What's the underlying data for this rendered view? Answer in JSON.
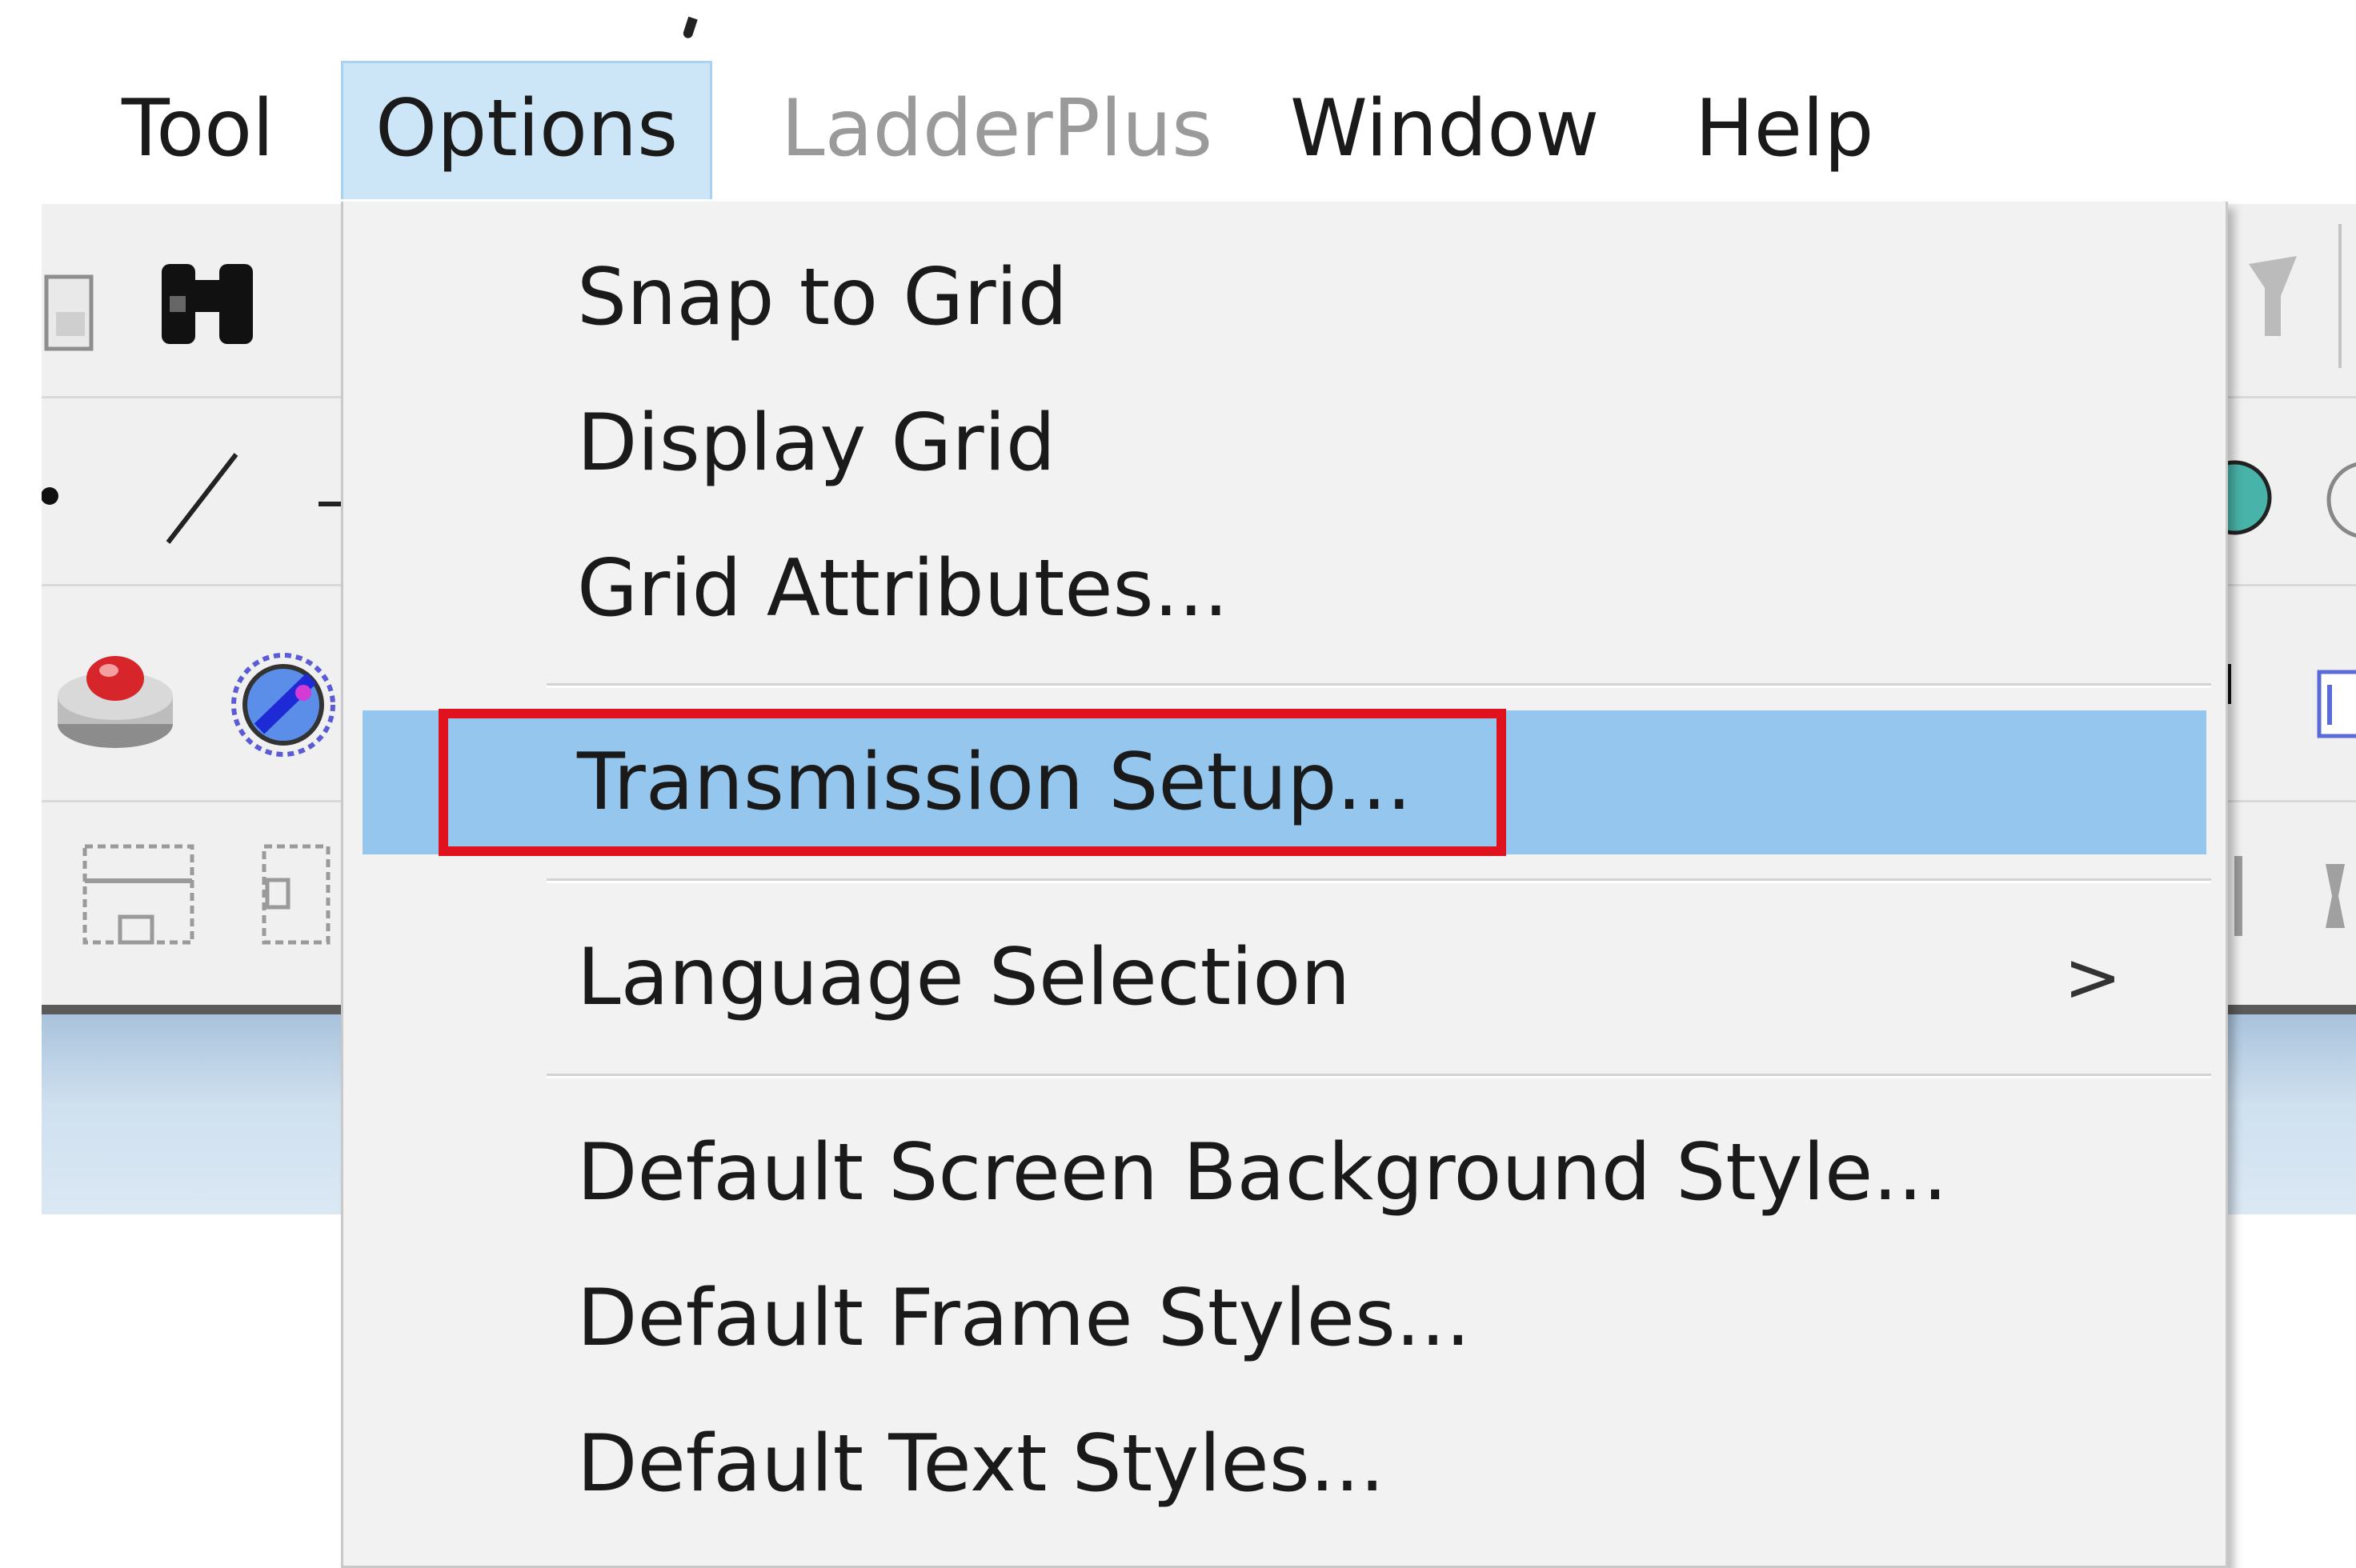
{
  "menubar": {
    "items": [
      {
        "label": "Tool",
        "state": "normal"
      },
      {
        "label": "Options",
        "state": "open"
      },
      {
        "label": "LadderPlus",
        "state": "disabled"
      },
      {
        "label": "Window",
        "state": "normal"
      },
      {
        "label": "Help",
        "state": "normal"
      }
    ]
  },
  "options_menu": {
    "items": [
      {
        "label": "Snap to Grid"
      },
      {
        "label": "Display Grid"
      },
      {
        "label": "Grid Attributes..."
      },
      {
        "label": "Transmission Setup...",
        "highlighted": true
      },
      {
        "label": "Language Selection",
        "submenu_arrow": ">"
      },
      {
        "label": "Default Screen Background Style..."
      },
      {
        "label": "Default Frame Styles..."
      },
      {
        "label": "Default Text Styles..."
      }
    ]
  },
  "toolbar": {
    "icons": [
      "save-icon",
      "find-binoculars-icon",
      "dot-icon",
      "line-tool-icon",
      "push-button-icon",
      "bit-lamp-icon",
      "frame-layout-icon",
      "split-layout-icon"
    ]
  },
  "colors": {
    "highlight": "#94c6ee",
    "annotation_box": "#e0121e",
    "menu_background": "#f2f2f2",
    "open_menu_title": "#cde6f7"
  }
}
